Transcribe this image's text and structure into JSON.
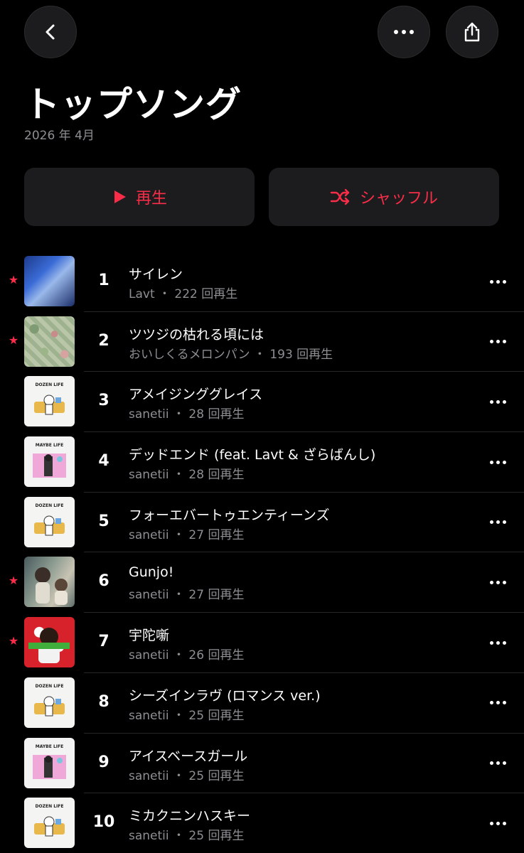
{
  "header": {
    "title": "トップソング",
    "subtitle": "2026 年 4月",
    "back_icon": "chevron-left-icon",
    "more_icon": "ellipsis-icon",
    "share_icon": "share-icon"
  },
  "actions": {
    "play_label": "再生",
    "shuffle_label": "シャッフル"
  },
  "colors": {
    "accent": "#fa2d48",
    "background": "#000000",
    "button_bg": "#1c1c1e",
    "secondary_text": "#8e8e93"
  },
  "songs": [
    {
      "rank": "1",
      "title": "サイレン",
      "meta": "Lavt ・ 222 回再生",
      "favorite": true
    },
    {
      "rank": "2",
      "title": "ツツジの枯れる頃には",
      "meta": "おいしくるメロンパン ・ 193 回再生",
      "favorite": true
    },
    {
      "rank": "3",
      "title": "アメイジンググレイス",
      "meta": "sanetii ・ 28 回再生",
      "favorite": false,
      "art_caption": "DOZEN LIFE"
    },
    {
      "rank": "4",
      "title": "デッドエンド (feat. Lavt & ざらばんし)",
      "meta": "sanetii ・ 28 回再生",
      "favorite": false,
      "art_caption": "MAYBE LIFE"
    },
    {
      "rank": "5",
      "title": "フォーエバートゥエンティーンズ",
      "meta": "sanetii ・ 27 回再生",
      "favorite": false,
      "art_caption": "DOZEN LIFE"
    },
    {
      "rank": "6",
      "title": "Gunjo!",
      "meta": "sanetii ・ 27 回再生",
      "favorite": true
    },
    {
      "rank": "7",
      "title": "宇陀噺",
      "meta": "sanetii ・ 26 回再生",
      "favorite": true
    },
    {
      "rank": "8",
      "title": "シーズインラヴ (ロマンス ver.)",
      "meta": "sanetii ・ 25 回再生",
      "favorite": false,
      "art_caption": "DOZEN LIFE"
    },
    {
      "rank": "9",
      "title": "アイスベースガール",
      "meta": "sanetii ・ 25 回再生",
      "favorite": false,
      "art_caption": "MAYBE LIFE"
    },
    {
      "rank": "10",
      "title": "ミカクニンハスキー",
      "meta": "sanetii ・ 25 回再生",
      "favorite": false,
      "art_caption": "DOZEN LIFE"
    }
  ]
}
